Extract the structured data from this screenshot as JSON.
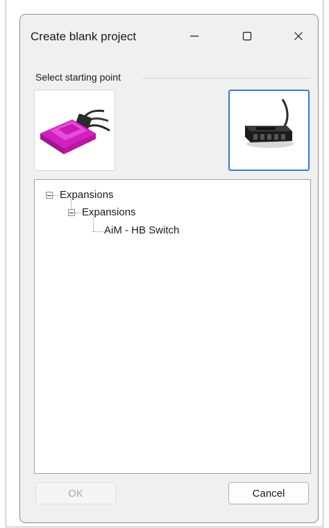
{
  "window": {
    "title": "Create blank project",
    "controls": {
      "minimize_icon": "minimize-icon",
      "maximize_icon": "maximize-icon",
      "close_icon": "close-icon"
    }
  },
  "starting_point": {
    "group_label": "Select starting point",
    "options": [
      {
        "icon": "magenta-device-thumbnail",
        "selected": false
      },
      {
        "icon": "black-switch-thumbnail",
        "selected": true
      }
    ]
  },
  "tree": {
    "nodes": [
      {
        "label": "Expansions",
        "level": 0,
        "expanded": true
      },
      {
        "label": "Expansions",
        "level": 1,
        "expanded": true
      },
      {
        "label": "AiM - HB Switch",
        "level": 2
      }
    ]
  },
  "buttons": {
    "ok_label": "OK",
    "ok_enabled": false,
    "cancel_label": "Cancel"
  },
  "colors": {
    "dialog_bg": "#f0f0f0",
    "selection_border": "#3b79c9",
    "device_magenta": "#d21fc0"
  }
}
